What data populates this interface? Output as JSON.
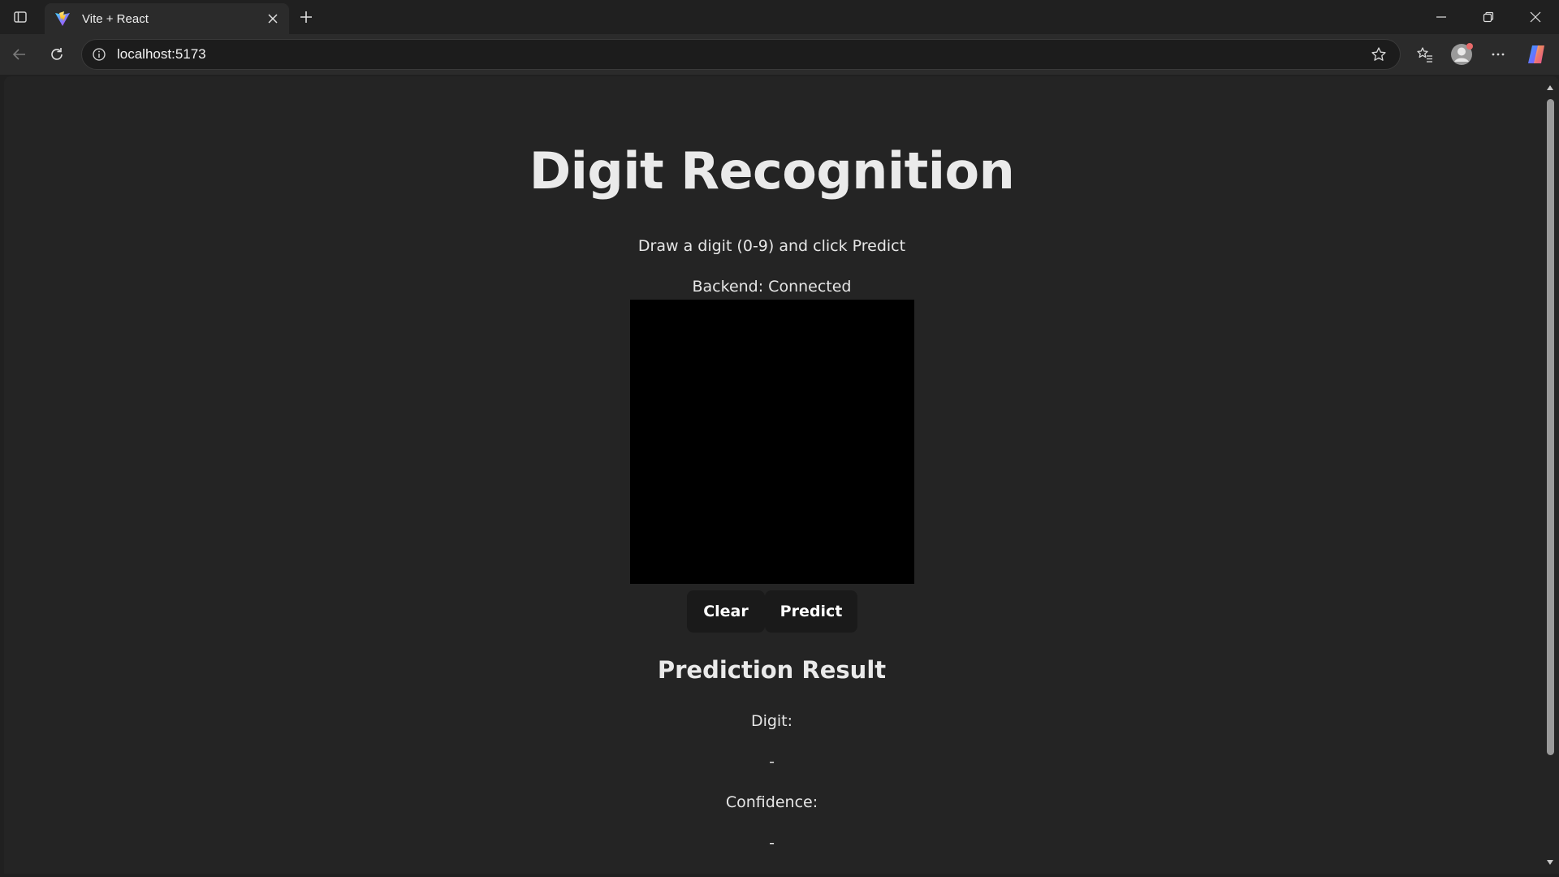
{
  "browser": {
    "tab": {
      "title": "Vite + React",
      "favicon": "vite-logo-icon"
    },
    "address": {
      "url": "localhost:5173"
    },
    "icons": {
      "tab_actions": "tab-actions-icon",
      "close_tab": "close-icon",
      "new_tab": "plus-icon",
      "back": "back-arrow-icon",
      "refresh": "refresh-icon",
      "site_info": "info-icon",
      "favorite": "star-icon",
      "favorites": "favorites-icon",
      "profile": "profile-icon",
      "more": "more-icon",
      "copilot": "copilot-icon"
    }
  },
  "app": {
    "title": "Digit Recognition",
    "subtitle": "Draw a digit (0-9) and click Predict",
    "backend_status": "Backend: Connected",
    "buttons": {
      "clear": "Clear",
      "predict": "Predict"
    },
    "result": {
      "heading": "Prediction Result",
      "digit_label": "Digit:",
      "digit_value": "-",
      "confidence_label": "Confidence:",
      "confidence_value": "-"
    }
  },
  "colors": {
    "page_background": "#242424",
    "canvas_background": "#000000",
    "button_background": "#1a1a1a",
    "text": "#e6e6e6"
  }
}
